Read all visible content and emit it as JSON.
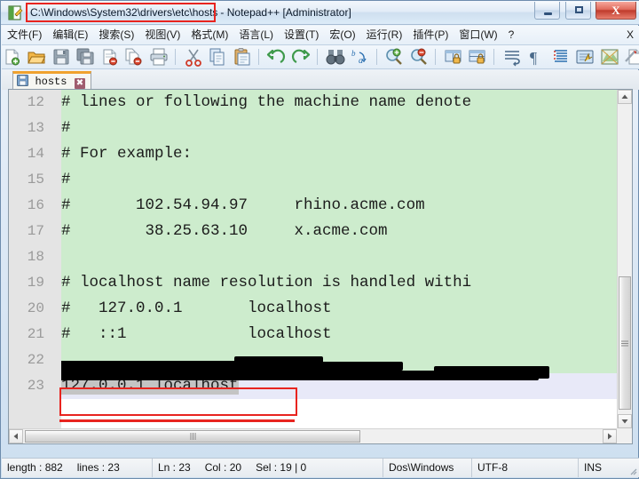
{
  "window": {
    "title_path": "C:\\Windows\\System32\\drivers\\etc\\hosts",
    "title_suffix": " - Notepad++ [Administrator]",
    "app_icon_name": "notepad-plus-plus-icon",
    "minimize_label": "",
    "maximize_label": "",
    "close_label": "X"
  },
  "menu": {
    "items": [
      {
        "label": "文件(F)",
        "name": "menu-file"
      },
      {
        "label": "编辑(E)",
        "name": "menu-edit"
      },
      {
        "label": "搜索(S)",
        "name": "menu-search"
      },
      {
        "label": "视图(V)",
        "name": "menu-view"
      },
      {
        "label": "格式(M)",
        "name": "menu-format"
      },
      {
        "label": "语言(L)",
        "name": "menu-language"
      },
      {
        "label": "设置(T)",
        "name": "menu-settings"
      },
      {
        "label": "宏(O)",
        "name": "menu-macro"
      },
      {
        "label": "运行(R)",
        "name": "menu-run"
      },
      {
        "label": "插件(P)",
        "name": "menu-plugins"
      },
      {
        "label": "窗口(W)",
        "name": "menu-window"
      },
      {
        "label": "?",
        "name": "menu-help"
      }
    ],
    "close_doc_label": "X"
  },
  "toolbar": {
    "buttons": [
      "new-file-icon",
      "open-folder-icon",
      "save-icon",
      "save-all-icon",
      "close-file-icon",
      "close-all-icon",
      "print-icon",
      "cut-scissors-icon",
      "copy-icon",
      "paste-icon",
      "undo-icon",
      "redo-icon",
      "find-binoculars-icon",
      "replace-icon",
      "zoom-in-icon",
      "zoom-out-icon",
      "sync-vertical-scroll-icon",
      "sync-horizontal-scroll-icon",
      "word-wrap-icon",
      "show-all-characters-icon",
      "indent-guide-icon",
      "user-defined-language-icon",
      "show-document-map-icon",
      "function-list-icon",
      "record-macro-icon",
      "stop-recording-icon",
      "play-macro-icon",
      "fast-forward-macro-icon"
    ]
  },
  "tab": {
    "label": "hosts",
    "icon_name": "save-floppy-icon",
    "close_label": "✖"
  },
  "editor": {
    "lines": [
      {
        "num": "12",
        "text": "# lines or following the machine name denote",
        "type": "comment"
      },
      {
        "num": "13",
        "text": "#",
        "type": "comment"
      },
      {
        "num": "14",
        "text": "# For example:",
        "type": "comment"
      },
      {
        "num": "15",
        "text": "#",
        "type": "comment"
      },
      {
        "num": "16",
        "text": "#       102.54.94.97     rhino.acme.com",
        "type": "comment"
      },
      {
        "num": "17",
        "text": "#        38.25.63.10     x.acme.com",
        "type": "comment"
      },
      {
        "num": "18",
        "text": "",
        "type": "comment"
      },
      {
        "num": "19",
        "text": "# localhost name resolution is handled withi",
        "type": "comment"
      },
      {
        "num": "20",
        "text": "#   127.0.0.1       localhost",
        "type": "comment"
      },
      {
        "num": "21",
        "text": "#   ::1             localhost",
        "type": "comment"
      },
      {
        "num": "22",
        "text": "",
        "type": "comment-redacted"
      },
      {
        "num": "23",
        "text": "127.0.0.1 localhost",
        "type": "current-selected"
      }
    ],
    "selection_color": "#c4c4c4",
    "comment_bg_color": "#cdeccd",
    "current_line_bg_color": "#e8e9f8",
    "annotation_color": "#e8241f"
  },
  "statusbar": {
    "length_label": "length : 882",
    "lines_label": "lines : 23",
    "ln_label": "Ln : 23",
    "col_label": "Col : 20",
    "sel_label": "Sel : 19 | 0",
    "eol_label": "Dos\\Windows",
    "encoding_label": "UTF-8",
    "insert_label": "INS"
  },
  "scrollbars": {
    "vertical_name": "editor-vertical-scrollbar",
    "horizontal_name": "editor-horizontal-scrollbar"
  }
}
